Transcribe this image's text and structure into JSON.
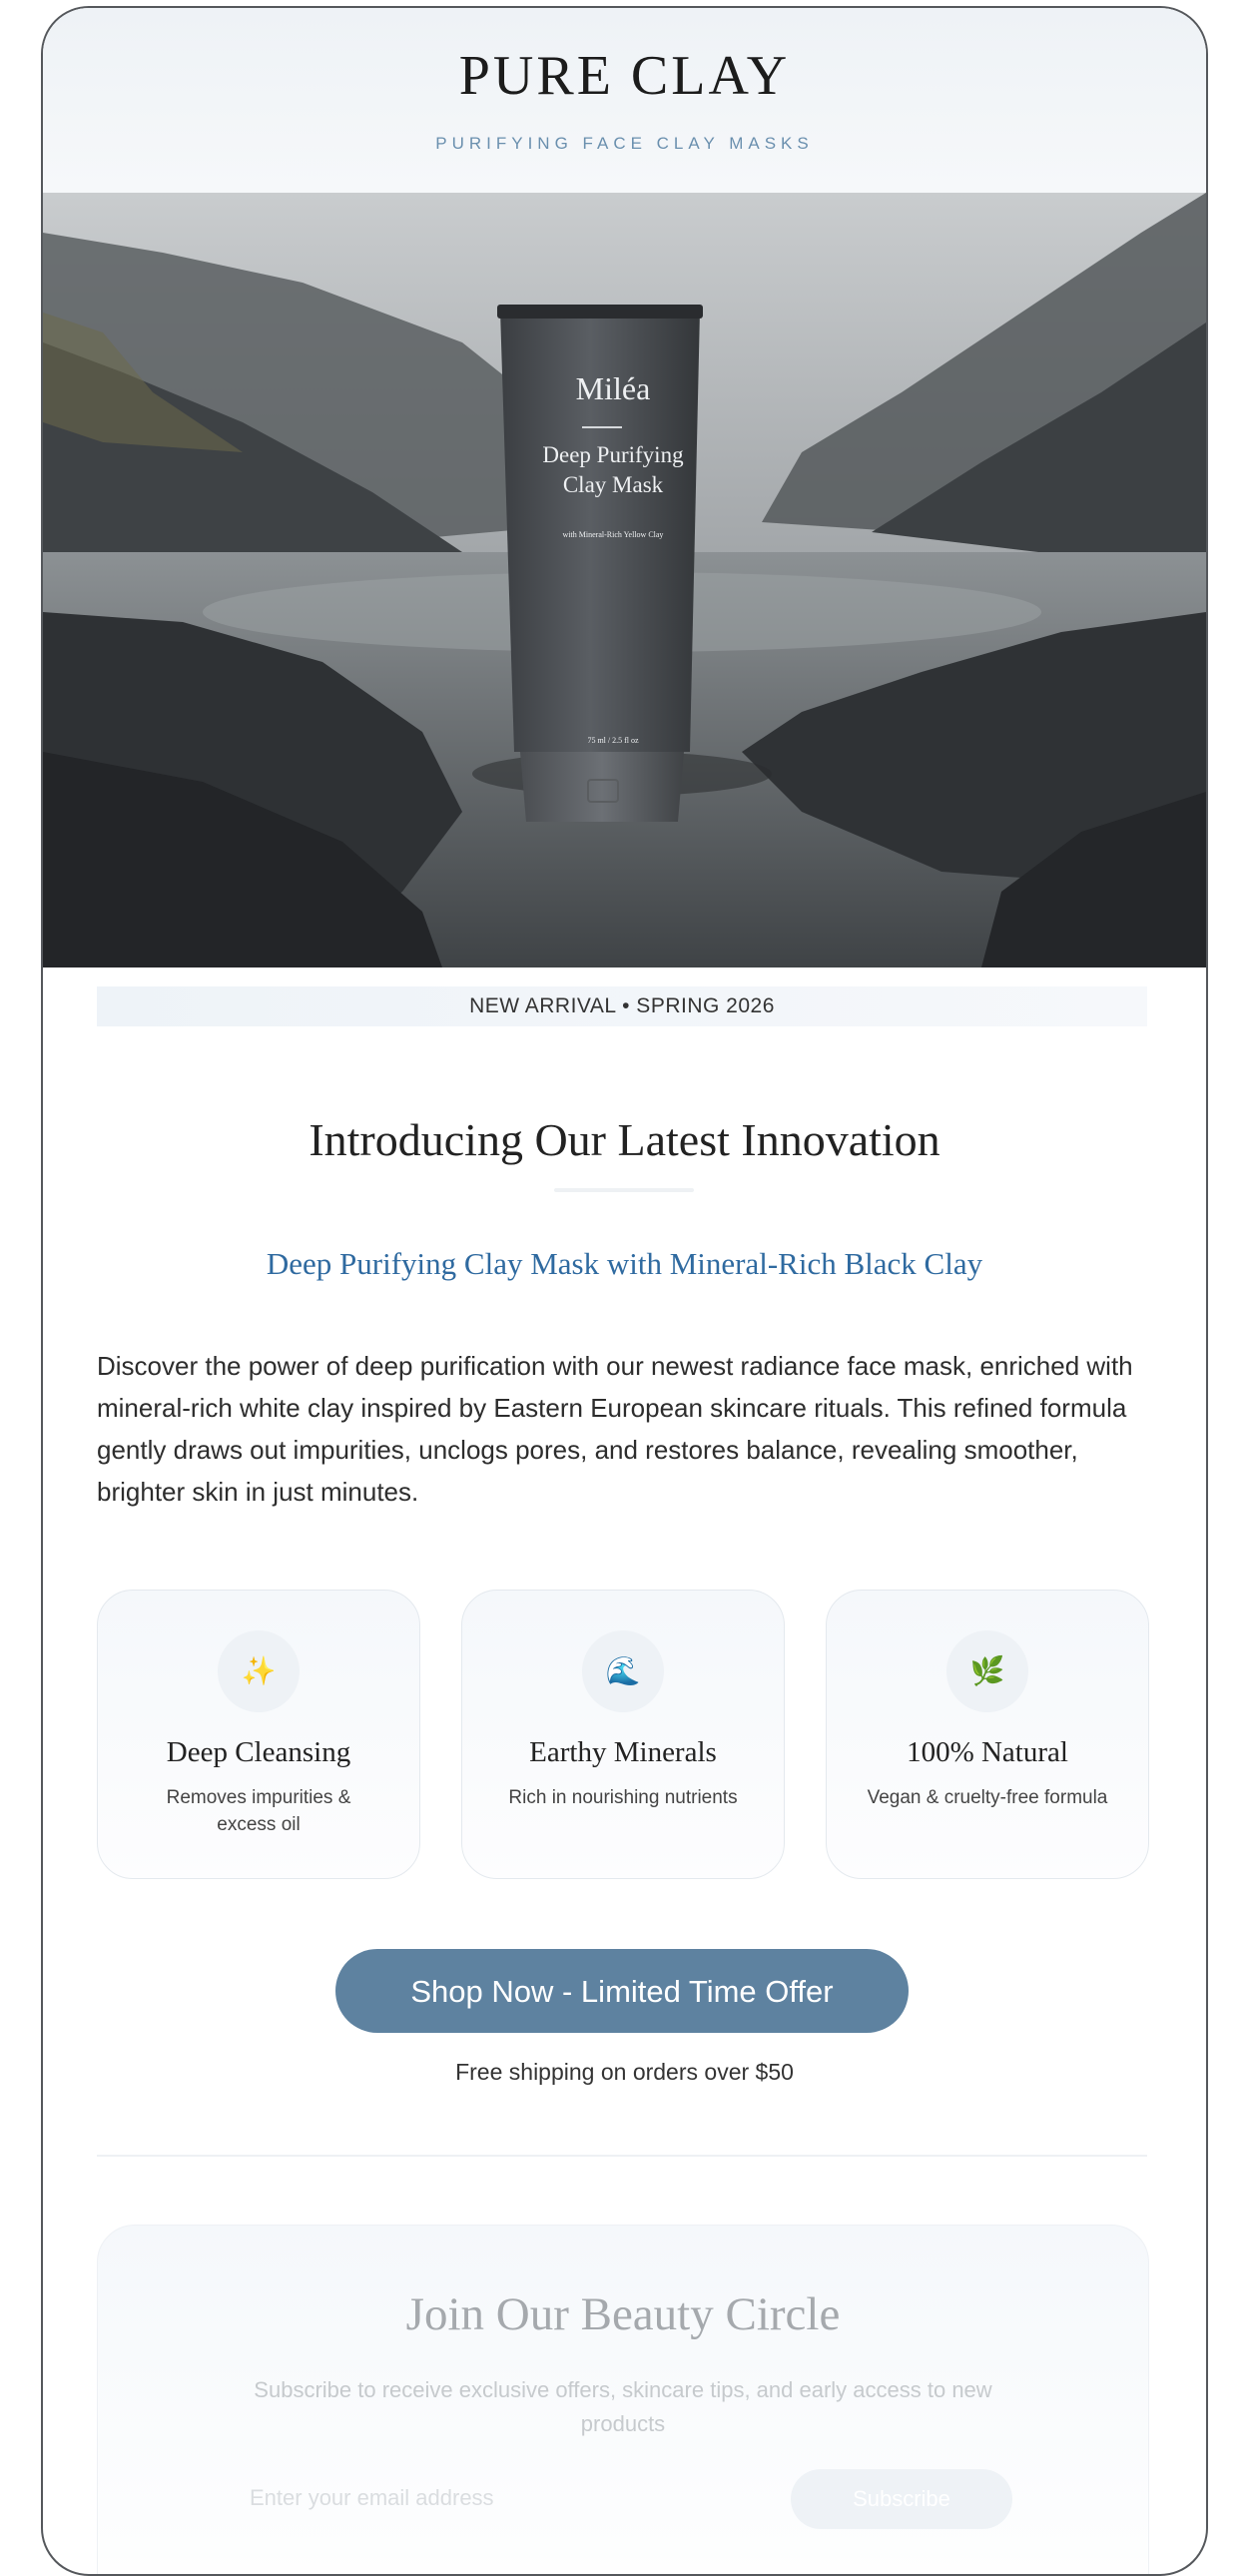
{
  "header": {
    "brand": "PURE CLAY",
    "tagline": "PURIFYING FACE CLAY MASKS"
  },
  "hero": {
    "product_brand": "Miléa",
    "product_name_line1": "Deep Purifying",
    "product_name_line2": "Clay Mask",
    "product_small_text": "with Mineral-Rich Yellow Clay",
    "product_volume": "75 ml / 2.5 fl oz"
  },
  "badge": "NEW ARRIVAL • SPRING 2026",
  "intro": {
    "title": "Introducing Our Latest Innovation",
    "subtitle": "Deep Purifying Clay Mask with Mineral-Rich Black Clay",
    "body": "Discover the power of deep purification with our newest radiance face mask, enriched with mineral-rich white clay inspired by Eastern European skincare rituals. This refined formula gently draws out impurities, unclogs pores, and restores balance, revealing smoother, brighter skin in just minutes."
  },
  "features": [
    {
      "icon": "sparkles-icon",
      "glyph": "✨",
      "title": "Deep Cleansing",
      "desc": "Removes impurities & excess oil"
    },
    {
      "icon": "wave-icon",
      "glyph": "🌊",
      "title": "Earthy Minerals",
      "desc": "Rich in nourishing nutrients"
    },
    {
      "icon": "herb-icon",
      "glyph": "🌿",
      "title": "100% Natural",
      "desc": "Vegan & cruelty-free formula"
    }
  ],
  "cta": {
    "label": "Shop Now - Limited Time Offer",
    "note": "Free shipping on orders over $50"
  },
  "newsletter": {
    "title": "Join Our Beauty Circle",
    "desc": "Subscribe to receive exclusive offers, skincare tips, and early access to new products",
    "placeholder": "Enter your email address",
    "button": "Subscribe"
  },
  "colors": {
    "accent": "#5e82a0",
    "subtitle": "#2f6aa0",
    "tagline": "#6a8fae"
  }
}
